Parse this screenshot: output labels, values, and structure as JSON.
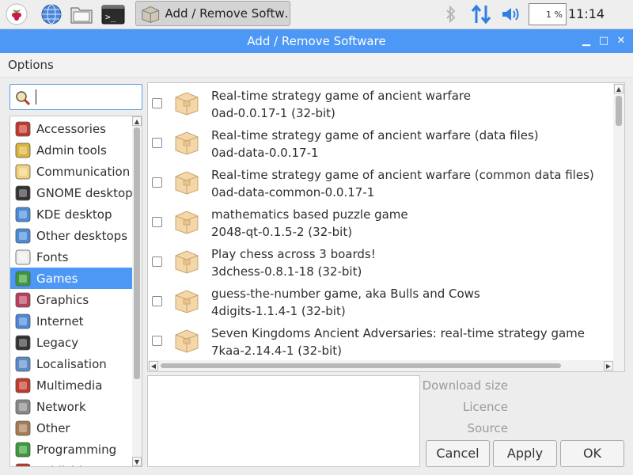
{
  "taskbar": {
    "task_label": "Add / Remove Softw…",
    "cpu_percent": "1 %",
    "clock": "11:14"
  },
  "window": {
    "title": "Add / Remove Software",
    "minimize": "▁",
    "maximize": "□",
    "close": "✕"
  },
  "menu": {
    "options": "Options"
  },
  "search": {
    "value": ""
  },
  "categories": [
    {
      "label": "Accessories",
      "icon": "accessories-icon"
    },
    {
      "label": "Admin tools",
      "icon": "admin-tools-icon"
    },
    {
      "label": "Communication",
      "icon": "communication-icon"
    },
    {
      "label": "GNOME desktop",
      "icon": "gnome-icon"
    },
    {
      "label": "KDE desktop",
      "icon": "kde-icon"
    },
    {
      "label": "Other desktops",
      "icon": "desktop-icon"
    },
    {
      "label": "Fonts",
      "icon": "fonts-icon"
    },
    {
      "label": "Games",
      "icon": "games-icon",
      "selected": true
    },
    {
      "label": "Graphics",
      "icon": "graphics-icon"
    },
    {
      "label": "Internet",
      "icon": "internet-icon"
    },
    {
      "label": "Legacy",
      "icon": "legacy-icon"
    },
    {
      "label": "Localisation",
      "icon": "localisation-icon"
    },
    {
      "label": "Multimedia",
      "icon": "multimedia-icon"
    },
    {
      "label": "Network",
      "icon": "network-icon"
    },
    {
      "label": "Other",
      "icon": "other-icon"
    },
    {
      "label": "Programming",
      "icon": "programming-icon"
    },
    {
      "label": "Publishing",
      "icon": "publishing-icon"
    }
  ],
  "packages": [
    {
      "description": "Real-time strategy game of ancient warfare",
      "version": "0ad-0.0.17-1 (32-bit)",
      "checked": false
    },
    {
      "description": "Real-time strategy game of ancient warfare (data files)",
      "version": "0ad-data-0.0.17-1",
      "checked": false
    },
    {
      "description": "Real-time strategy game of ancient warfare (common data files)",
      "version": "0ad-data-common-0.0.17-1",
      "checked": false
    },
    {
      "description": "mathematics based puzzle game",
      "version": "2048-qt-0.1.5-2 (32-bit)",
      "checked": false
    },
    {
      "description": "Play chess across 3 boards!",
      "version": "3dchess-0.8.1-18 (32-bit)",
      "checked": false
    },
    {
      "description": "guess-the-number game, aka Bulls and Cows",
      "version": "4digits-1.1.4-1 (32-bit)",
      "checked": false
    },
    {
      "description": "Seven Kingdoms Ancient Adversaries: real-time strategy game",
      "version": "7kaa-2.14.4-1 (32-bit)",
      "checked": false
    }
  ],
  "details": {
    "download_size_label": "Download size",
    "licence_label": "Licence",
    "source_label": "Source"
  },
  "buttons": {
    "cancel": "Cancel",
    "apply": "Apply",
    "ok": "OK"
  },
  "colors": {
    "accent": "#4d98f5",
    "selection_text": "#ffffff"
  }
}
